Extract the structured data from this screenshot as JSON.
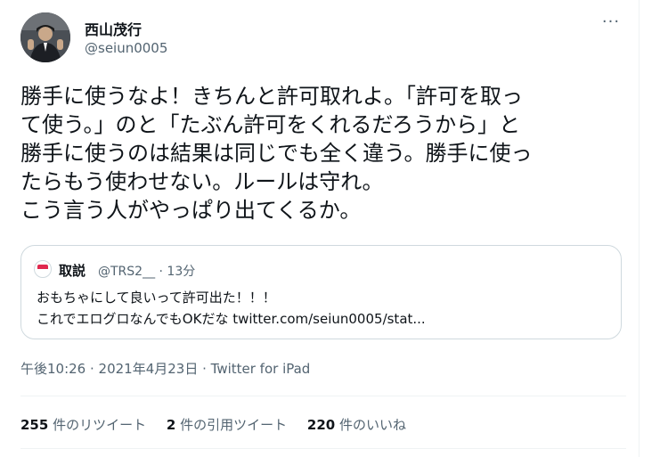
{
  "tweet": {
    "author_name": "西山茂行",
    "author_handle": "@seiun0005",
    "more_label": "···",
    "text": "勝手に使うなよ！きちんと許可取れよ。「許可を取っ\nて使う。」のと「たぶん許可をくれるだろうから」と\n勝手に使うのは結果は同じでも全く違う。勝手に使っ\nたらもう使わせない。ルールは守れ。\nこう言う人がやっぱり出てくるか。",
    "timestamp": "午後10:26 · 2021年4月23日 · Twitter for iPad"
  },
  "quoted": {
    "name": "取説",
    "meta": "@TRS2__ · 13分",
    "text": "おもちゃにして良いって許可出た！！！\nこれでエログロなんでもOKだな twitter.com/seiun0005/stat..."
  },
  "stats": [
    {
      "count": "255",
      "label": "件のリツイート"
    },
    {
      "count": "2",
      "label": "件の引用ツイート"
    },
    {
      "count": "220",
      "label": "件のいいね"
    }
  ],
  "icons": {
    "author_avatar": "avatar-photo",
    "quoted_avatar": "avatar-icon",
    "more": "more-icon"
  },
  "colors": {
    "secondary_text": "#536471",
    "border": "#cfd9de"
  }
}
